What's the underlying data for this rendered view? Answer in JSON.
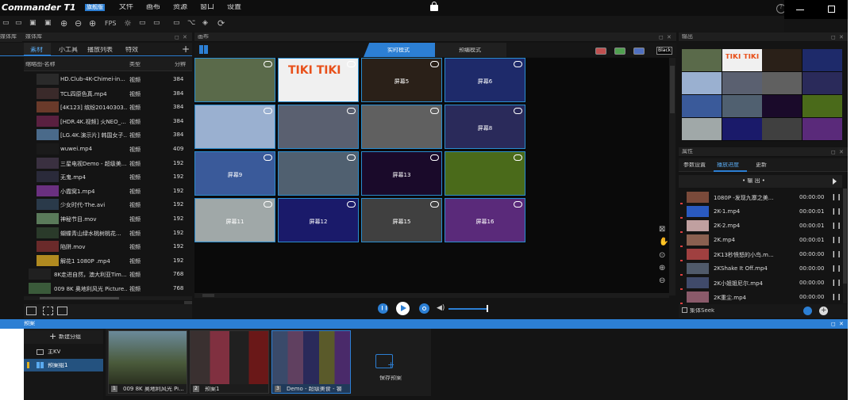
{
  "app": {
    "title_prefix": "Commander T1",
    "edition_badge": "旗舰版"
  },
  "menu": [
    "文件",
    "画布",
    "资源",
    "窗口",
    "设置"
  ],
  "toolbar": {
    "fps_label": "FPS"
  },
  "media_library": {
    "title": "媒体库",
    "tabs": [
      "素材",
      "小工具",
      "播放列表",
      "特效"
    ],
    "columns": {
      "name": "缩略图-名称",
      "type": "类型",
      "size": "分辨"
    },
    "rows": [
      {
        "name": "HD.Club-4K-Chimei-in...",
        "type": "视频",
        "size": "384"
      },
      {
        "name": "TCL四原色真.mp4",
        "type": "视频",
        "size": "384"
      },
      {
        "name": "[4K123] 缤纷20140303...",
        "type": "视频",
        "size": "384"
      },
      {
        "name": "[HDR.4K.视频] 火NEO_...",
        "type": "视频",
        "size": "384"
      },
      {
        "name": "[LG.4K.演示片] 韩国女子...",
        "type": "视频",
        "size": "384"
      },
      {
        "name": "wuwei.mp4",
        "type": "视频",
        "size": "409"
      },
      {
        "name": "三星电视Demo - 超级美...",
        "type": "视频",
        "size": "192"
      },
      {
        "name": "无鬼.mp4",
        "type": "视频",
        "size": "192"
      },
      {
        "name": "小霞窝1.mp4",
        "type": "视频",
        "size": "192"
      },
      {
        "name": "少女时代-The.avi",
        "type": "视频",
        "size": "192"
      },
      {
        "name": "神秘节目.mov",
        "type": "视频",
        "size": "192"
      },
      {
        "name": "蝴蝶青山绿水桃树桃花...",
        "type": "视频",
        "size": "192"
      },
      {
        "name": "陷阱.mov",
        "type": "视频",
        "size": "192"
      },
      {
        "name": "解花1 1080P .mp4",
        "type": "视频",
        "size": "192"
      },
      {
        "name": "8K走进自然，澳大利亚Tim...",
        "type": "视频",
        "size": "768"
      },
      {
        "name": "009 8K 奥地利风光 Picture...",
        "type": "视频",
        "size": "768"
      }
    ]
  },
  "canvas": {
    "title": "画布",
    "mode_tabs": [
      "实时模式",
      "预编模式"
    ],
    "black_label": "Black",
    "cell_labels": [
      "",
      "",
      "屏幕5",
      "屏幕6",
      "",
      "",
      "",
      "屏幕8",
      "屏幕9",
      "",
      "屏幕13",
      "",
      "屏幕11",
      "屏幕12",
      "屏幕15",
      "屏幕16"
    ],
    "cell_colors": [
      "#5a6a4a",
      "#f0f0f0",
      "#2a2018",
      "#1e2a6a",
      "#9ab0d0",
      "#5a6070",
      "#606060",
      "#2a2a5a",
      "#3a5a9a",
      "#506070",
      "#1a0a2a",
      "#4a6a1a",
      "#a0a8a8",
      "#1a1a6a",
      "#404040",
      "#5a2a7a"
    ],
    "tiki_text": "TIKI TIKI"
  },
  "output": {
    "title": "输出",
    "tiki_text": "TIKI TIKI"
  },
  "properties": {
    "title": "属性",
    "tabs": [
      "参数设置",
      "播放进度",
      "更新"
    ],
    "output_label": "• 输 出 •",
    "items": [
      {
        "name": "1080P -发现九寨之美...",
        "time": "00:00:00"
      },
      {
        "name": "2K-1.mp4",
        "time": "00:00:01"
      },
      {
        "name": "2K-2.mp4",
        "time": "00:00:01"
      },
      {
        "name": "2K.mp4",
        "time": "00:00:01"
      },
      {
        "name": "2K13秒愤怒的小鸟.m...",
        "time": "00:00:00"
      },
      {
        "name": "2KShake It Off.mp4",
        "time": "00:00:00"
      },
      {
        "name": "2K小姐姐尼尔.mp4",
        "time": "00:00:00"
      },
      {
        "name": "2K重尘.mp4",
        "time": "00:00:00"
      }
    ],
    "pause_symbol": "❙❙",
    "group_seek_label": "集体Seek"
  },
  "preset": {
    "title": "预案",
    "new_group_label": "新建分组",
    "groups": [
      "主KV",
      "预案组1"
    ],
    "cards": [
      {
        "index": "1",
        "label": "009 8K 奥地利风光 Pi..."
      },
      {
        "index": "2",
        "label": "预案1"
      },
      {
        "index": "3",
        "label": "Demo - 超级美食 - 饕"
      }
    ],
    "save_label": "保存预案"
  },
  "colors": {
    "accent": "#2c7fd4",
    "cell_border": "#2a8dd0",
    "bg": "#141414"
  }
}
